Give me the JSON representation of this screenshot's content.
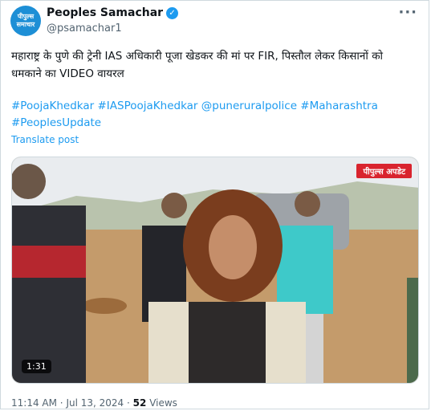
{
  "author": {
    "avatar_line1": "पीपुल्स",
    "avatar_line2": "समाचार",
    "display_name": "Peoples Samachar",
    "handle": "@psamachar1",
    "verified_icon": "✓",
    "verified_color": "#1d9bf0"
  },
  "more_label": "···",
  "tweet": {
    "text": "महाराष्ट्र के पुणे की ट्रेनी IAS अधिकारी पूजा खेडकर की मां पर FIR, पिस्तौल लेकर किसानों को धमकाने का VIDEO वायरल",
    "hashtags": "#PoojaKhedkar #IASPoojaKhedkar @puneruralpolice #Maharashtra #PeoplesUpdate",
    "translate_label": "Translate post"
  },
  "media": {
    "watermark": "पीपुल्स अपडेट",
    "duration": "1:31"
  },
  "meta": {
    "time": "11:14 AM",
    "separator": "·",
    "date": "Jul 13, 2024",
    "views_count": "52",
    "views_label": "Views"
  },
  "colors": {
    "accent": "#1d9bf0",
    "watermark_red": "#d9242e",
    "avatar_blue": "#1d8fd6"
  }
}
